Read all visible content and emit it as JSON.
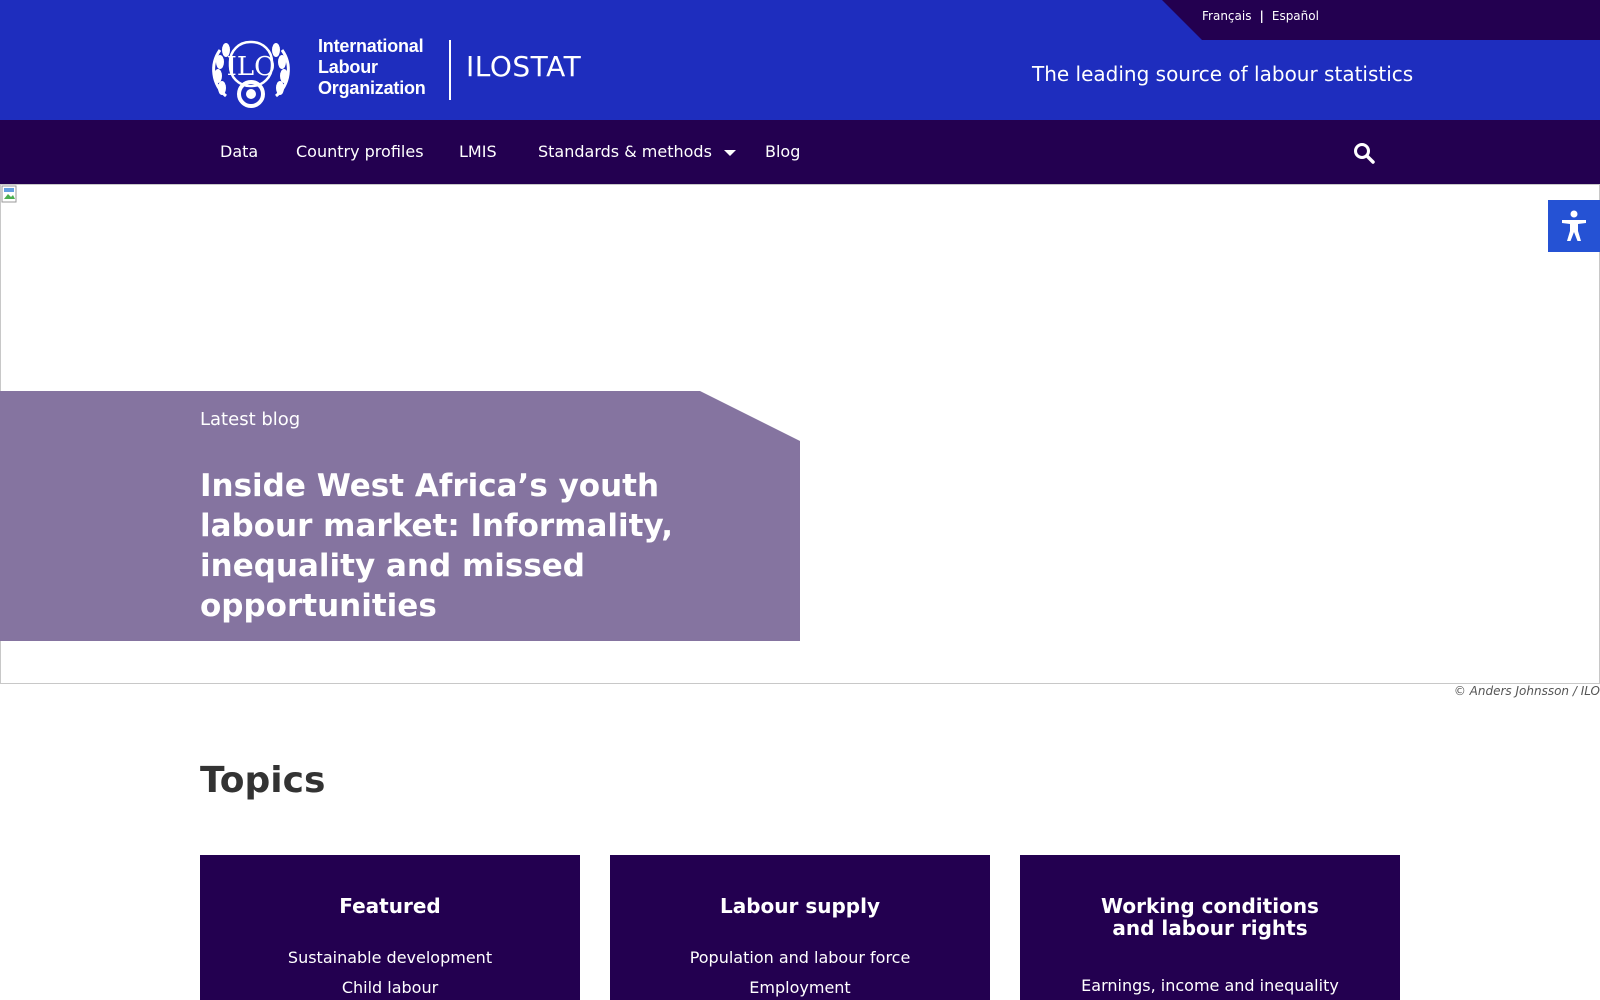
{
  "header": {
    "languages": [
      "Français",
      "Español"
    ],
    "logo_text": [
      "International",
      "Labour",
      "Organization"
    ],
    "brand": "ILOSTAT",
    "tagline": "The leading source of labour statistics"
  },
  "nav": {
    "items": [
      "Data",
      "Country profiles",
      "LMIS",
      "Standards & methods",
      "Blog"
    ]
  },
  "hero": {
    "kicker": "Latest blog",
    "title": "Inside West Africa’s youth labour market: Informality, inequality and missed opportunities",
    "credit": "© Anders Johnsson / ILO"
  },
  "topics": {
    "heading": "Topics",
    "cards": [
      {
        "title_lines": [
          "Featured"
        ],
        "links": [
          "Sustainable development",
          "Child labour"
        ]
      },
      {
        "title_lines": [
          "Labour supply"
        ],
        "links": [
          "Population and labour force",
          "Employment"
        ]
      },
      {
        "title_lines": [
          "Working conditions",
          "and labour rights"
        ],
        "links": [
          "Earnings, income and inequality"
        ]
      }
    ]
  },
  "colors": {
    "primary_blue": "#1e2dbe",
    "dark_purple": "#230050",
    "blog_panel": "#8574a0",
    "accessibility_blue": "#2552d4"
  }
}
